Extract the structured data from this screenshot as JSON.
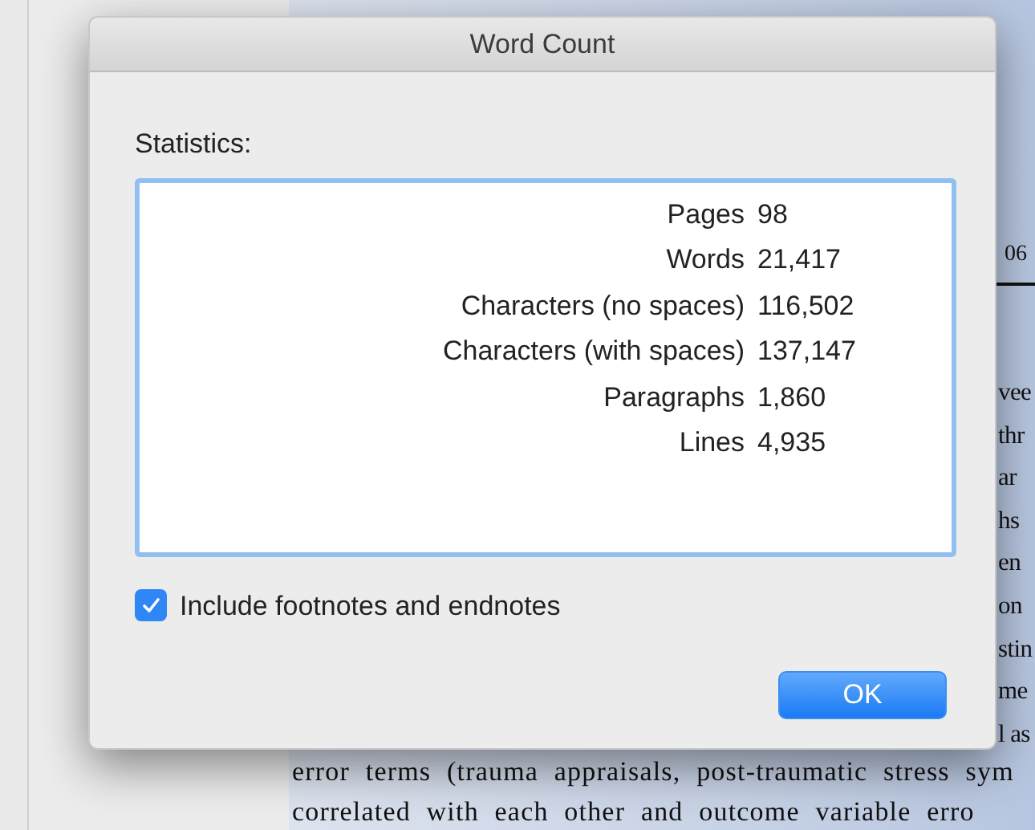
{
  "window": {
    "title": "Word Count"
  },
  "statistics": {
    "label": "Statistics:",
    "rows": [
      {
        "name": "Pages",
        "value": "98"
      },
      {
        "name": "Words",
        "value": "21,417"
      },
      {
        "name": "Characters (no spaces)",
        "value": "116,502"
      },
      {
        "name": "Characters (with spaces)",
        "value": "137,147"
      },
      {
        "name": "Paragraphs",
        "value": "1,860"
      },
      {
        "name": "Lines",
        "value": "4,935"
      }
    ]
  },
  "include_notes": {
    "label": "Include footnotes and endnotes",
    "checked": true
  },
  "buttons": [
    {
      "label": "OK",
      "default": true
    }
  ],
  "background_document": {
    "figure_label": "06",
    "fragments": [
      "vee",
      "thr",
      "ar",
      "hs",
      "en",
      "on",
      "stin",
      "me",
      "l as"
    ],
    "lines": [
      "error terms (trauma appraisals, post-traumatic stress sym",
      "correlated with each other and outcome variable erro"
    ]
  }
}
